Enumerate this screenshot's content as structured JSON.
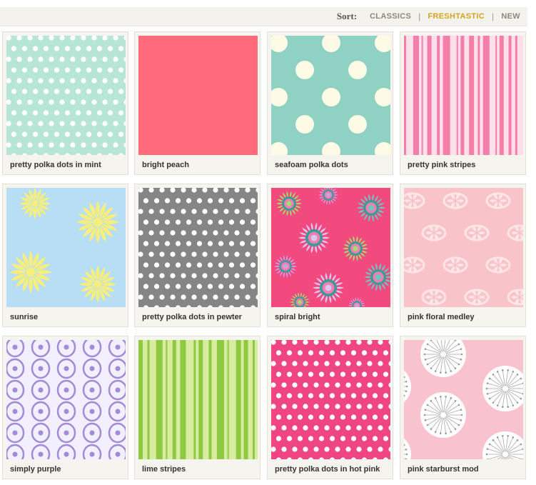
{
  "sort": {
    "label": "Sort:",
    "options": [
      {
        "label": "CLASSICS",
        "active": false
      },
      {
        "label": "FRESHTASTIC",
        "active": true
      },
      {
        "label": "NEW",
        "active": false
      }
    ],
    "separator": "|"
  },
  "colors": {
    "accent": "#d4a41c",
    "muted": "#8a8a7a",
    "tile_bg": "#f5f4ef"
  },
  "patterns": [
    {
      "name": "pretty polka dots in mint",
      "pattern": "polka-small",
      "bg": "#b8e6d6",
      "fg": "#ffffff"
    },
    {
      "name": "bright peach",
      "pattern": "solid",
      "bg": "#ff6b7a",
      "fg": "#ff6b7a"
    },
    {
      "name": "seafoam polka dots",
      "pattern": "polka-large",
      "bg": "#8fd1c3",
      "fg": "#fdfbe6"
    },
    {
      "name": "pretty pink stripes",
      "pattern": "stripes-pink",
      "bg": "#fde0ea",
      "fg": "#f47ea8"
    },
    {
      "name": "sunrise",
      "pattern": "starburst-yellow",
      "bg": "#b7def5",
      "fg": "#f7ee7b"
    },
    {
      "name": "pretty polka dots in pewter",
      "pattern": "polka-small",
      "bg": "#858585",
      "fg": "#ffffff"
    },
    {
      "name": "spiral bright",
      "pattern": "spirals",
      "bg": "#f2497f",
      "fg": "#9fe06a"
    },
    {
      "name": "pink floral medley",
      "pattern": "damask-pink",
      "bg": "#f9c4c9",
      "fg": "#fde6e8"
    },
    {
      "name": "simply purple",
      "pattern": "damask-purple",
      "bg": "#f2efff",
      "fg": "#a28bd6"
    },
    {
      "name": "lime stripes",
      "pattern": "stripes-lime",
      "bg": "#d8ec9f",
      "fg": "#8fc944"
    },
    {
      "name": "pretty polka dots in hot pink",
      "pattern": "polka-small",
      "bg": "#ef4580",
      "fg": "#ffffff"
    },
    {
      "name": "pink starburst mod",
      "pattern": "starburst-mod",
      "bg": "#f9c2cf",
      "fg": "#ffffff"
    }
  ]
}
